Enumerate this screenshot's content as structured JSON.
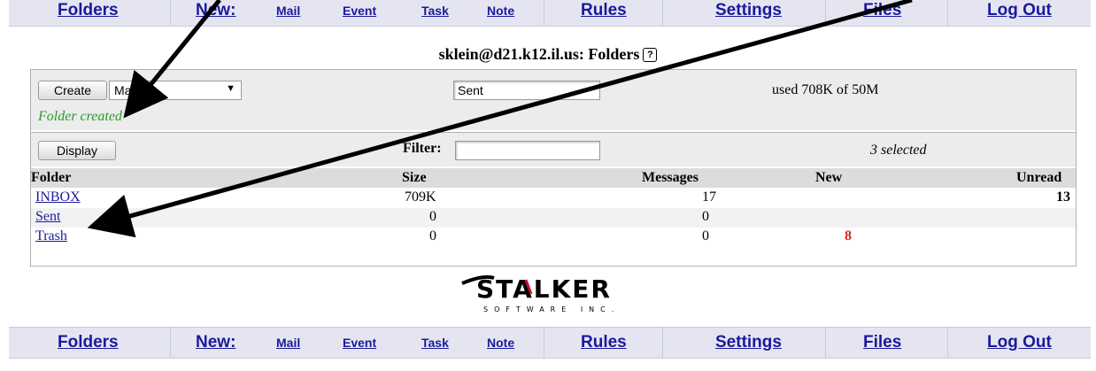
{
  "nav": {
    "folders": "Folders",
    "new": "New:",
    "mail": "Mail",
    "event": "Event",
    "task": "Task",
    "note": "Note",
    "rules": "Rules",
    "settings": "Settings",
    "files": "Files",
    "logout": "Log Out"
  },
  "page_title": "sklein@d21.k12.il.us: Folders",
  "help_glyph": "?",
  "create": {
    "button": "Create",
    "type_value": "Mailbox",
    "name_value": "Sent",
    "quota": "used 708K of 50M",
    "status": "Folder created"
  },
  "display": {
    "button": "Display",
    "filter_label": "Filter:",
    "filter_value": "",
    "selected": "3 selected"
  },
  "table": {
    "headers": {
      "folder": "Folder",
      "size": "Size",
      "messages": "Messages",
      "new": "New",
      "unread": "Unread"
    },
    "rows": [
      {
        "folder": "INBOX",
        "size": "709K",
        "messages": "17",
        "new": "",
        "unread": "13"
      },
      {
        "folder": "Sent",
        "size": "0",
        "messages": "0",
        "new": "",
        "unread": ""
      },
      {
        "folder": "Trash",
        "size": "0",
        "messages": "0",
        "new": "8",
        "unread": ""
      }
    ]
  },
  "logo": {
    "name": "STALKER",
    "tagline": "SOFTWARE INC."
  },
  "colors": {
    "nav_bg": "#e5e5f2",
    "link": "#1a1a9c",
    "status_green": "#2a9a2a",
    "new_count_red": "#e02020",
    "band_gray": "#ececec"
  }
}
